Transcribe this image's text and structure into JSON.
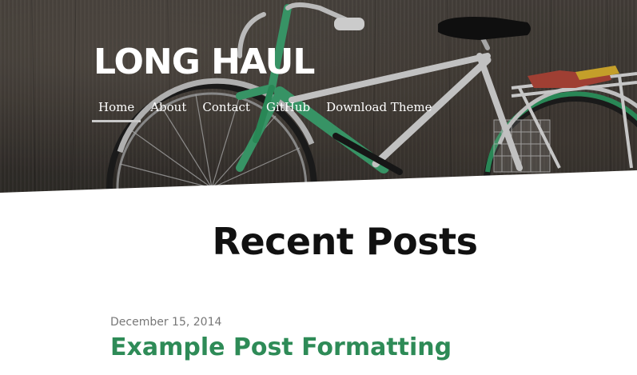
{
  "site": {
    "title": "LONG HAUL"
  },
  "nav": {
    "items": [
      {
        "label": "Home",
        "active": true
      },
      {
        "label": "About",
        "active": false
      },
      {
        "label": "Contact",
        "active": false
      },
      {
        "label": "GitHub",
        "active": false
      },
      {
        "label": "Download Theme",
        "active": false
      }
    ]
  },
  "main": {
    "section_title": "Recent Posts",
    "posts": [
      {
        "date": "December 15, 2014",
        "title": "Example Post Formatting"
      }
    ]
  },
  "colors": {
    "accent_green": "#2e8b57",
    "title_dark": "#111111",
    "date_gray": "#777777",
    "nav_underline": "#c9c9c9"
  },
  "icons": {
    "hero_image": "bicycle-photo"
  }
}
